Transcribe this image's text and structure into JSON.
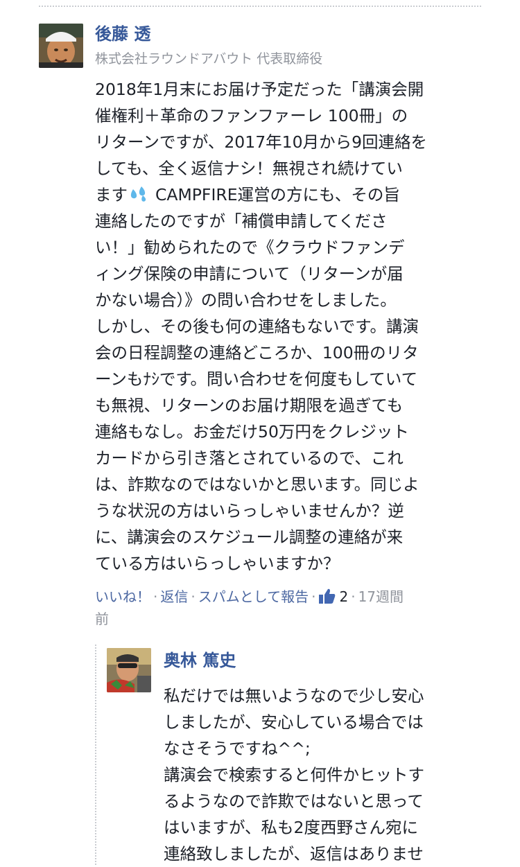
{
  "comment": {
    "author": "後藤 透",
    "author_title": "株式会社ラウンドアバウト 代表取締役",
    "avatar_icon": "user-avatar-photo",
    "body_lines": [
      "2018年1月末にお届け予定だった「講演会開",
      "催権利＋革命のファンファーレ 100冊」の",
      "リターンですが、2017年10月から9回連絡を",
      "しても、全く返信ナシ！無視され続けてい",
      "ます",
      "CAMPFIRE運営の方にも、その旨",
      "連絡したのですが「補償申請してくださ",
      "い！」勧められたので《クラウドファンデ",
      "ィング保険の申請について（リターンが届",
      "かない場合）》の問い合わせをしました。",
      "しかし、その後も何の連絡もないです。講演",
      "会の日程調整の連絡どころか、100冊のリタ",
      "ーンもﾅｼです。問い合わせを何度もしていて",
      "も無視、リターンのお届け期限を過ぎても",
      "連絡もなし。お金だけ50万円をクレジット",
      "カードから引き落とされているので、これ",
      "は、詐欺なのではないかと思います。同じよ",
      "うな状況の方はいらっしゃいませんか？逆",
      "に、講演会のスケジュール調整の連絡が来",
      "ている方はいらっしゃいますか？"
    ],
    "actions": {
      "like": "いいね！",
      "reply": "返信",
      "report": "スパムとして報告",
      "like_count": "2",
      "time_part1": "17週間",
      "time_part2": "前",
      "separator": "·"
    }
  },
  "reply": {
    "author": "奥林 篤史",
    "avatar_icon": "user-avatar-photo",
    "body_lines": [
      "私だけでは無いようなので少し安心",
      "しましたが、安心している場合では",
      "なさそうですね^^;",
      "講演会で検索すると何件かヒットす",
      "るようなので詐欺ではないと思って",
      "はいますが、私も2度西野さん宛に",
      "連絡致しましたが、返信はありませ"
    ]
  },
  "colors": {
    "name": "#365899",
    "meta": "#90949c",
    "link": "#4b67a1",
    "text": "#1d2129",
    "like_icon": "#4267b2"
  }
}
